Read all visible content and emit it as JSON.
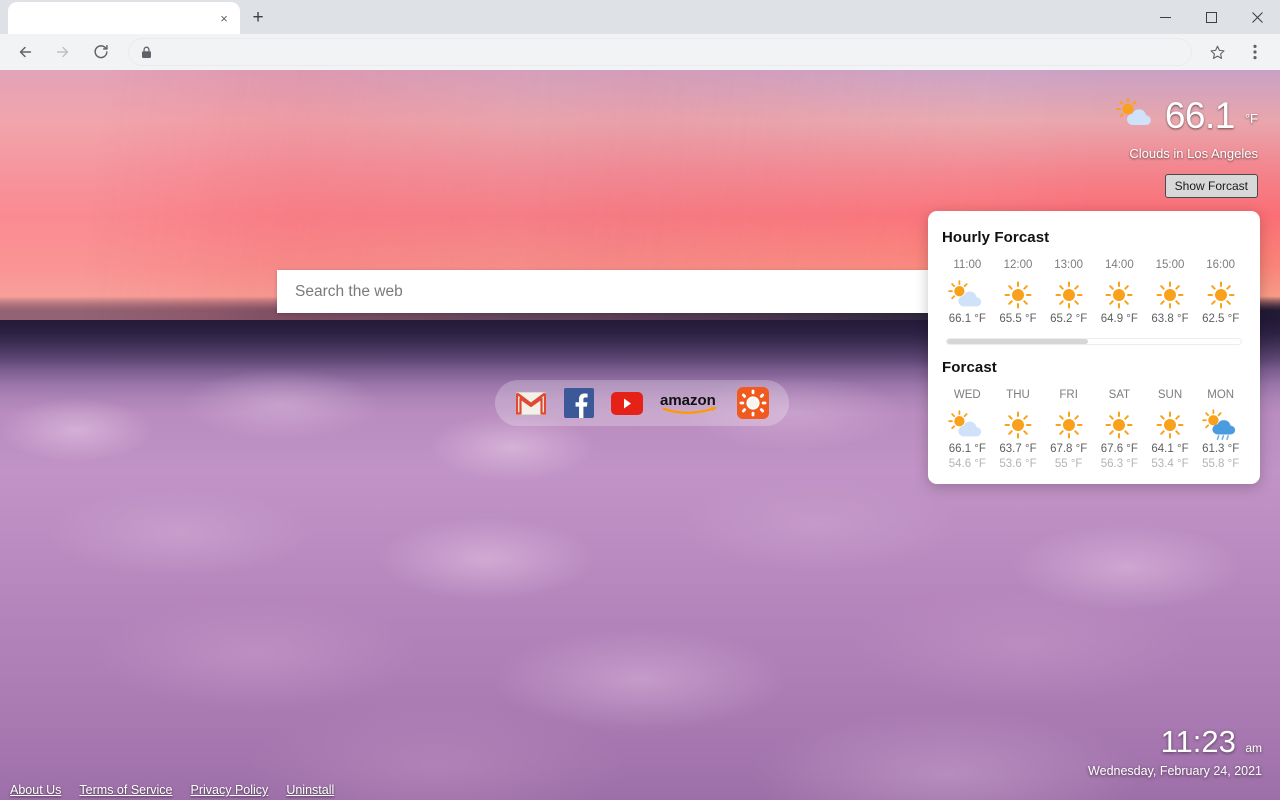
{
  "browser": {
    "tab": {
      "title": "",
      "close_label": "×",
      "name": "browser-tab"
    },
    "new_tab_label": "+",
    "window_controls": {
      "minimize": "–",
      "maximize": "☐",
      "close": "✕"
    },
    "toolbar": {
      "back_label": "←",
      "forward_label": "→",
      "reload_label": "⟳",
      "omnibox_value": "",
      "omnibox_placeholder": "",
      "lock_icon": "lock-icon",
      "bookmark_icon": "star-icon",
      "menu_icon": "three-dot-menu-icon"
    }
  },
  "search": {
    "placeholder": "Search the web"
  },
  "shortcuts": [
    {
      "name": "gmail",
      "label": "Gmail"
    },
    {
      "name": "facebook",
      "label": "Facebook"
    },
    {
      "name": "youtube",
      "label": "YouTube"
    },
    {
      "name": "amazon",
      "label": "amazon"
    },
    {
      "name": "extension",
      "label": "Extension"
    }
  ],
  "weather": {
    "temperature": "66.1",
    "unit": "°F",
    "description": "Clouds in Los Angeles",
    "icon": "sun-behind-cloud-icon",
    "show_forecast_label": "Show Forcast"
  },
  "forecast_panel": {
    "hourly_title": "Hourly Forcast",
    "daily_title": "Forcast",
    "scroll_thumb_percent": 48,
    "hourly": [
      {
        "time": "11:00",
        "icon": "sun-behind-cloud-icon",
        "temp": "66.1 °F"
      },
      {
        "time": "12:00",
        "icon": "sun-icon",
        "temp": "65.5 °F"
      },
      {
        "time": "13:00",
        "icon": "sun-icon",
        "temp": "65.2 °F"
      },
      {
        "time": "14:00",
        "icon": "sun-icon",
        "temp": "64.9 °F"
      },
      {
        "time": "15:00",
        "icon": "sun-icon",
        "temp": "63.8 °F"
      },
      {
        "time": "16:00",
        "icon": "sun-icon",
        "temp": "62.5 °F"
      }
    ],
    "daily": [
      {
        "day": "WED",
        "icon": "sun-behind-cloud-icon",
        "high": "66.1 °F",
        "low": "54.6 °F"
      },
      {
        "day": "THU",
        "icon": "sun-icon",
        "high": "63.7 °F",
        "low": "53.6 °F"
      },
      {
        "day": "FRI",
        "icon": "sun-icon",
        "high": "67.8 °F",
        "low": "55 °F"
      },
      {
        "day": "SAT",
        "icon": "sun-icon",
        "high": "67.6 °F",
        "low": "56.3 °F"
      },
      {
        "day": "SUN",
        "icon": "sun-icon",
        "high": "64.1 °F",
        "low": "53.4 °F"
      },
      {
        "day": "MON",
        "icon": "sun-behind-rain-cloud-icon",
        "high": "61.3 °F",
        "low": "55.8 °F"
      }
    ]
  },
  "clock": {
    "time": "11:23",
    "ampm": "am",
    "date": "Wednesday, February 24, 2021"
  },
  "footer_links": [
    {
      "label": "About Us"
    },
    {
      "label": "Terms of Service"
    },
    {
      "label": "Privacy Policy"
    },
    {
      "label": "Uninstall"
    }
  ],
  "colors": {
    "sun": "#f9a11b",
    "cloud_light": "#cfe2f9",
    "cloud_rain": "#4a9be0",
    "panel_bg": "#ffffff"
  }
}
